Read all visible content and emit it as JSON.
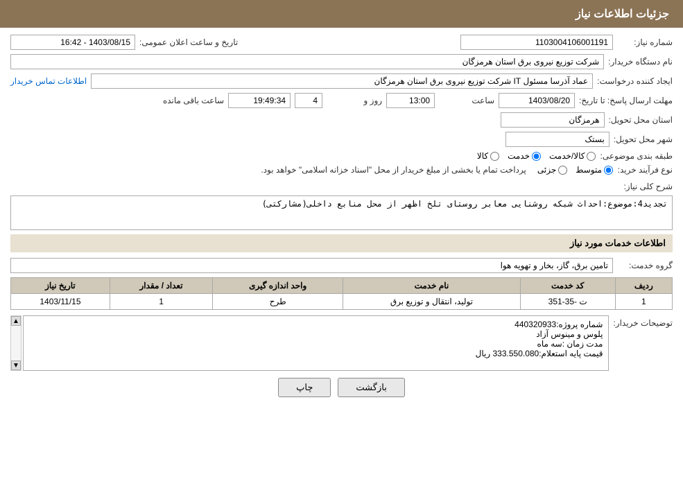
{
  "header": {
    "title": "جزئیات اطلاعات نیاز"
  },
  "fields": {
    "shomareNiaz_label": "شماره نیاز:",
    "shomareNiaz_value": "1103004106001191",
    "namDastgah_label": "نام دستگاه خریدار:",
    "namDastgah_value": "شرکت توزیع نیروی برق استان هرمزگان",
    "tarikh_label": "تاریخ و ساعت اعلان عمومی:",
    "tarikh_value": "1403/08/15 - 16:42",
    "ijadKonande_label": "ایجاد کننده درخواست:",
    "ijadKonande_value": "عماد آذرسا مسئول IT شرکت توزیع نیروی برق استان هرمزگان",
    "ijadKonande_link": "اطلاعات تماس خریدار",
    "mohlatErsalPasokh_label": "مهلت ارسال پاسخ: تا تاریخ:",
    "mohlatDate": "1403/08/20",
    "mohlatSaat_label": "ساعت",
    "mohlatSaat_value": "13:00",
    "mohlatRoz_label": "روز و",
    "mohlatRoz_value": "4",
    "mohlatMande_label": "ساعت باقی مانده",
    "mohlatMande_value": "19:49:34",
    "ostanTahvil_label": "استان محل تحویل:",
    "ostanTahvil_value": "هرمزگان",
    "shahrTahvil_label": "شهر محل تحویل:",
    "shahrTahvil_value": "بستک",
    "tabaqeBandi_label": "طبقه بندی موضوعی:",
    "tabaqe_kala": "کالا",
    "tabaqe_khedmat": "خدمت",
    "tabaqe_kalaKhedmat": "کالا/خدمت",
    "tabaqe_selected": "khedmat",
    "noFarayand_label": "نوع فرآیند خرید:",
    "noFarayand_jozee": "جزئی",
    "noFarayand_motovaset": "متوسط",
    "noFarayand_note": "پرداخت تمام یا بخشی از مبلغ خریدار از محل \"اسناد خزانه اسلامی\" خواهد بود.",
    "noFarayand_selected": "motovaset",
    "sharhKolli_label": "شرح کلی نیاز:",
    "sharhKolli_value": "تجدید4:موضوع:احداث شبکه روشنایی معابر روستای تلخ اظهر از محل منابع داخلی(مشارکتی)",
    "khadamatInfo_title": "اطلاعات خدمات مورد نیاز",
    "grohKhedmat_label": "گروه خدمت:",
    "grohKhedmat_value": "تامین برق، گاز، بخار و تهویه هوا",
    "table": {
      "headers": [
        "ردیف",
        "کد خدمت",
        "نام خدمت",
        "واحد اندازه گیری",
        "تعداد / مقدار",
        "تاریخ نیاز"
      ],
      "rows": [
        {
          "radif": "1",
          "kodKhedmat": "ت -35-351",
          "namKhedmat": "تولید، انتقال و توزیع برق",
          "vahed": "طرح",
          "tedad": "1",
          "tarikh": "1403/11/15"
        }
      ]
    },
    "tozihatKharidar_label": "توضیحات خریدار:",
    "tozihatKharidar_value": "شماره پروژه:440320933\nپلوس و مینوس آزاد\nمدت زمان :سه ماه\nقیمت پایه استعلام:333.550.080 ریال"
  },
  "buttons": {
    "print": "چاپ",
    "back": "بازگشت"
  }
}
